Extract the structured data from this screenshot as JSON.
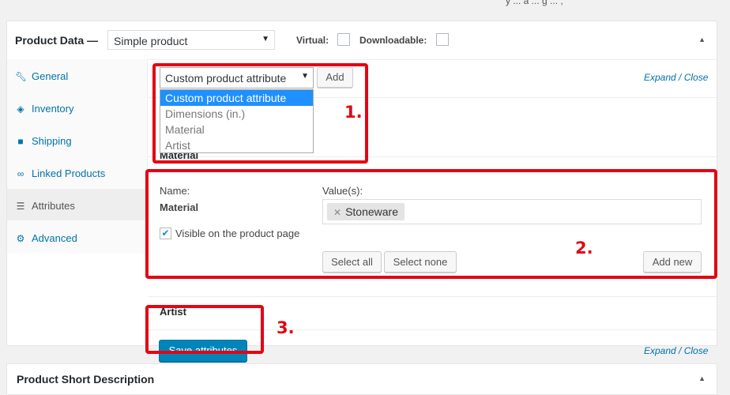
{
  "top_fragment": "y ... a ... g ... ,",
  "product_data": {
    "title": "Product Data —",
    "product_type": "Simple product",
    "virtual_label": "Virtual:",
    "downloadable_label": "Downloadable:",
    "collapse_icon": "triangle-up-icon"
  },
  "tabs": [
    {
      "label": "General",
      "icon": "wrench-icon"
    },
    {
      "label": "Inventory",
      "icon": "tag-icon"
    },
    {
      "label": "Shipping",
      "icon": "truck-icon"
    },
    {
      "label": "Linked Products",
      "icon": "link-icon"
    },
    {
      "label": "Attributes",
      "icon": "list-icon"
    },
    {
      "label": "Advanced",
      "icon": "gear-icon"
    }
  ],
  "attributes": {
    "select_value": "Custom product attribute",
    "add_label": "Add",
    "expand_close": "Expand / Close",
    "dropdown_options": [
      "Custom product attribute",
      "Dimensions (in.)",
      "Material",
      "Artist"
    ],
    "material_heading": "Material",
    "name_label": "Name:",
    "name_value": "Material",
    "visible_label": "Visible on the product page",
    "visible_checked": true,
    "values_label": "Value(s):",
    "values": [
      "Stoneware"
    ],
    "select_all": "Select all",
    "select_none": "Select none",
    "add_new": "Add new",
    "artist_heading": "Artist",
    "save_label": "Save attributes"
  },
  "annotations": [
    "1.",
    "2.",
    "3."
  ],
  "short_description": {
    "title": "Product Short Description"
  }
}
